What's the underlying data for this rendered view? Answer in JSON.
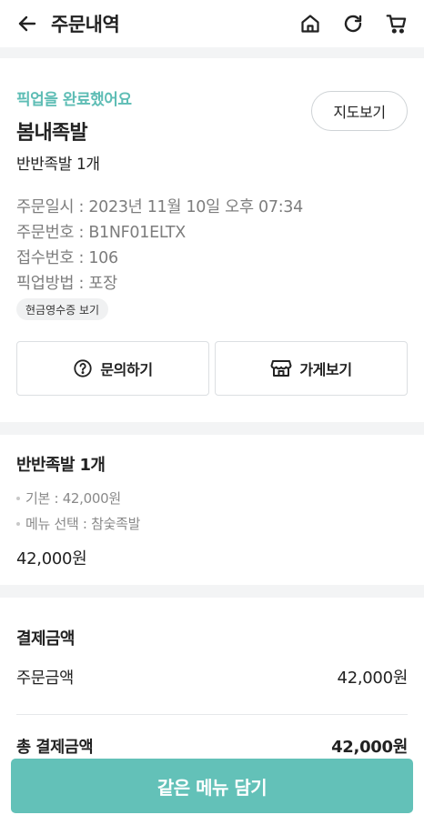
{
  "header": {
    "title": "주문내역",
    "icons": [
      "arrow-left-icon",
      "home-icon",
      "refresh-icon",
      "cart-icon"
    ]
  },
  "order": {
    "status": "픽업을 완료했어요",
    "store_name": "봄내족발",
    "summary": "반반족발 1개",
    "map_button": "지도보기",
    "info": [
      "주문일시 : 2023년 11월 10일 오후 07:34",
      "주문번호 : B1NF01ELTX",
      "접수번호 : 106",
      "픽업방법 : 포장"
    ],
    "receipt_chip": "현금영수증 보기",
    "inquiry_button": "문의하기",
    "store_button": "가게보기"
  },
  "menu": {
    "title": "반반족발 1개",
    "options": [
      "기본 : 42,000원",
      "메뉴 선택 : 참숯족발"
    ],
    "price": "42,000원"
  },
  "payment": {
    "title": "결제금액",
    "order_amount_label": "주문금액",
    "order_amount_value": "42,000원",
    "total_label": "총 결제금액",
    "total_value": "42,000원"
  },
  "cta": {
    "label": "같은 메뉴 담기"
  },
  "colors": {
    "accent": "#5ebdb5",
    "cta_background": "#63c1b8",
    "section_gap": "#f3f4f5",
    "muted_text": "#7d7d7d"
  }
}
